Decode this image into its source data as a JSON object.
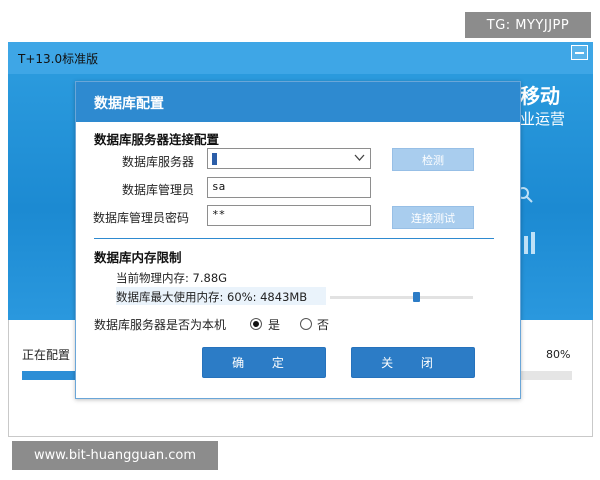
{
  "watermark_top": "TG: MYYJJPP",
  "watermark_bottom": "www.bit-huangguan.com",
  "installer": {
    "title": "T+13.0标准版",
    "promo_line1": "移动",
    "promo_line2": "业运营",
    "progress_label": "正在配置",
    "progress_percent": "80%",
    "progress_value": 0.8
  },
  "dialog": {
    "title": "数据库配置",
    "section_connection": "数据库服务器连接配置",
    "server_label": "数据库服务器",
    "server_value": "",
    "check_button": "检测",
    "admin_label": "数据库管理员",
    "admin_value": "sa",
    "password_label": "数据库管理员密码",
    "password_value": "**",
    "test_button": "连接测试",
    "section_memory": "数据库内存限制",
    "physical_memory": "当前物理内存: 7.88G",
    "max_memory": "数据库最大使用内存: 60%: 4843MB",
    "memory_slider_value": 0.6,
    "local_question": "数据库服务器是否为本机",
    "yes_label": "是",
    "no_label": "否",
    "yes_selected": true,
    "ok_button": "确 定",
    "close_button": "关 闭"
  },
  "colors": {
    "accent": "#2e8ad0",
    "banner": "#1c8ad2",
    "button_primary": "#2c7cc6",
    "button_light": "#a9cdee"
  }
}
